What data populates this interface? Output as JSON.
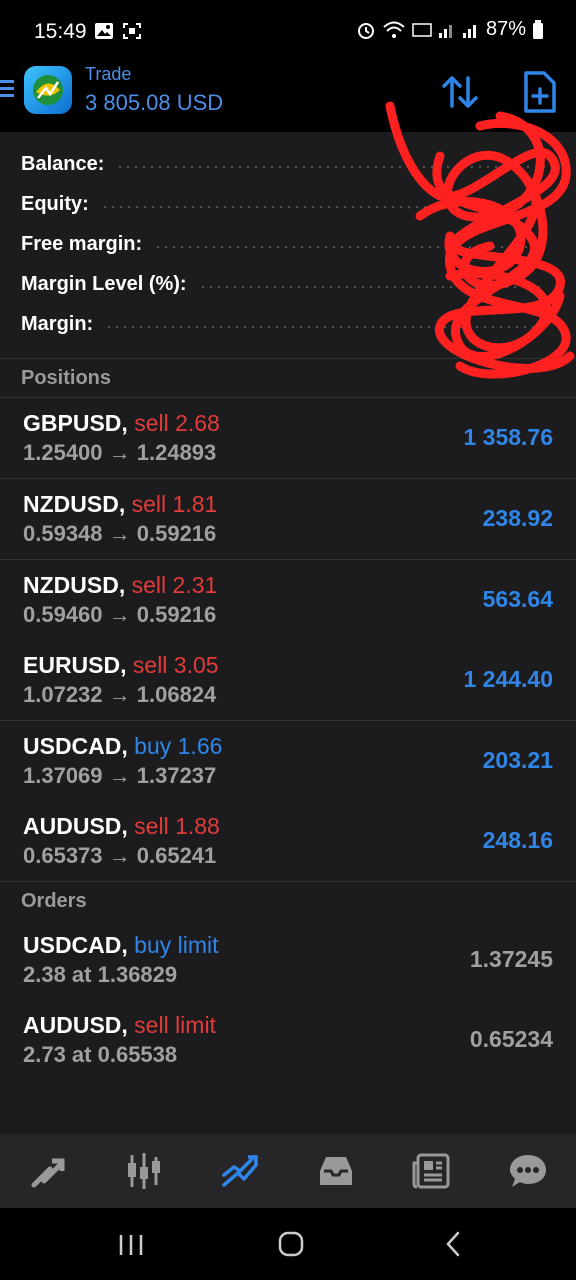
{
  "status_bar": {
    "time": "15:49",
    "battery": "87%",
    "left_icons": [
      "image-icon",
      "screenshot-icon"
    ],
    "right_icons": [
      "alarm-icon",
      "wifi-icon",
      "volte-icon",
      "signal-icon",
      "signal-icon",
      "battery-icon"
    ]
  },
  "header": {
    "title": "Trade",
    "balance": "3 805.08 USD"
  },
  "summary": {
    "rows": [
      {
        "label": "Balance:",
        "value": ""
      },
      {
        "label": "Equity:",
        "value": ""
      },
      {
        "label": "Free margin:",
        "value": ""
      },
      {
        "label": "Margin Level (%):",
        "value": ""
      },
      {
        "label": "Margin:",
        "value": ""
      }
    ]
  },
  "positions": {
    "title": "Positions",
    "items": [
      {
        "symbol": "GBPUSD,",
        "side": "sell 2.68",
        "prices": "1.25400 → 1.24893",
        "profit": "1 358.76",
        "direction": "sell"
      },
      {
        "symbol": "NZDUSD,",
        "side": "sell 1.81",
        "prices": "0.59348 → 0.59216",
        "profit": "238.92",
        "direction": "sell"
      },
      {
        "symbol": "NZDUSD,",
        "side": "sell 2.31",
        "prices": "0.59460 → 0.59216",
        "profit": "563.64",
        "direction": "sell"
      },
      {
        "symbol": "EURUSD,",
        "side": "sell 3.05",
        "prices": "1.07232 → 1.06824",
        "profit": "1 244.40",
        "direction": "sell"
      },
      {
        "symbol": "USDCAD,",
        "side": "buy 1.66",
        "prices": "1.37069 → 1.37237",
        "profit": "203.21",
        "direction": "buy"
      },
      {
        "symbol": "AUDUSD,",
        "side": "sell 1.88",
        "prices": "0.65373 → 0.65241",
        "profit": "248.16",
        "direction": "sell"
      }
    ]
  },
  "orders": {
    "title": "Orders",
    "items": [
      {
        "symbol": "USDCAD,",
        "side": "buy limit",
        "details": "2.38 at 1.36829",
        "price": "1.37245",
        "direction": "buy"
      },
      {
        "symbol": "AUDUSD,",
        "side": "sell limit",
        "details": "2.73 at 0.65538",
        "price": "0.65234",
        "direction": "sell"
      }
    ]
  },
  "bottom_nav": [
    "quotes-icon",
    "chart-icon",
    "trade-icon",
    "history-icon",
    "news-icon",
    "messages-icon"
  ],
  "colors": {
    "accent": "#2f86e8",
    "sell": "#e33a3a",
    "buy": "#2f86e8",
    "panel": "#1c1c1e"
  }
}
